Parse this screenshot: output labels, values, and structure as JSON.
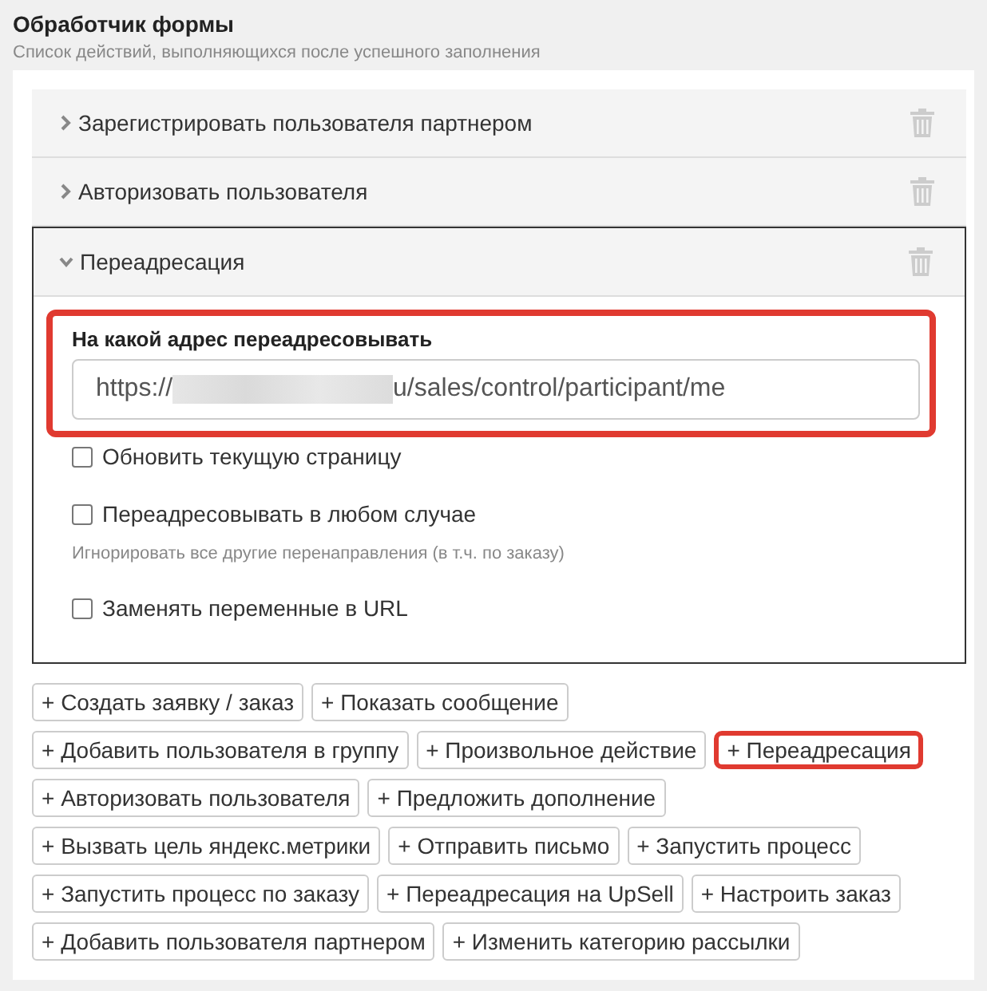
{
  "header": {
    "title": "Обработчик формы",
    "subtitle": "Список действий, выполняющихся после успешного заполнения"
  },
  "actions": [
    {
      "label": "Зарегистрировать пользователя партнером",
      "expanded": false
    },
    {
      "label": "Авторизовать пользователя",
      "expanded": false
    },
    {
      "label": "Переадресация",
      "expanded": true,
      "url_field": {
        "label": "На какой адрес переадресовывать",
        "value_start": "https://",
        "redacted": true,
        "value_end": "u/sales/control/participant/me",
        "highlighted": true
      },
      "options": [
        {
          "label": "Обновить текущую страницу",
          "checked": false
        },
        {
          "label": "Переадресовывать в любом случае",
          "checked": false,
          "hint": "Игнорировать все другие перенаправления (в т.ч. по заказу)"
        },
        {
          "label": "Заменять переменные в URL",
          "checked": false
        }
      ]
    }
  ],
  "add_buttons": [
    {
      "label": "+ Создать заявку / заказ",
      "highlighted": false
    },
    {
      "label": "+ Показать сообщение",
      "highlighted": false
    },
    {
      "label": "+ Добавить пользователя в группу",
      "highlighted": false
    },
    {
      "label": "+ Произвольное действие",
      "highlighted": false
    },
    {
      "label": "+ Переадресация",
      "highlighted": true
    },
    {
      "label": "+ Авторизовать пользователя",
      "highlighted": false
    },
    {
      "label": "+ Предложить дополнение",
      "highlighted": false
    },
    {
      "label": "+ Вызвать цель яндекс.метрики",
      "highlighted": false
    },
    {
      "label": "+ Отправить письмо",
      "highlighted": false
    },
    {
      "label": "+ Запустить процесс",
      "highlighted": false
    },
    {
      "label": "+ Запустить процесс по заказу",
      "highlighted": false
    },
    {
      "label": "+ Переадресация на UpSell",
      "highlighted": false
    },
    {
      "label": "+ Настроить заказ",
      "highlighted": false
    },
    {
      "label": "+ Добавить пользователя партнером",
      "highlighted": false
    },
    {
      "label": "+ Изменить категорию рассылки",
      "highlighted": false
    }
  ]
}
